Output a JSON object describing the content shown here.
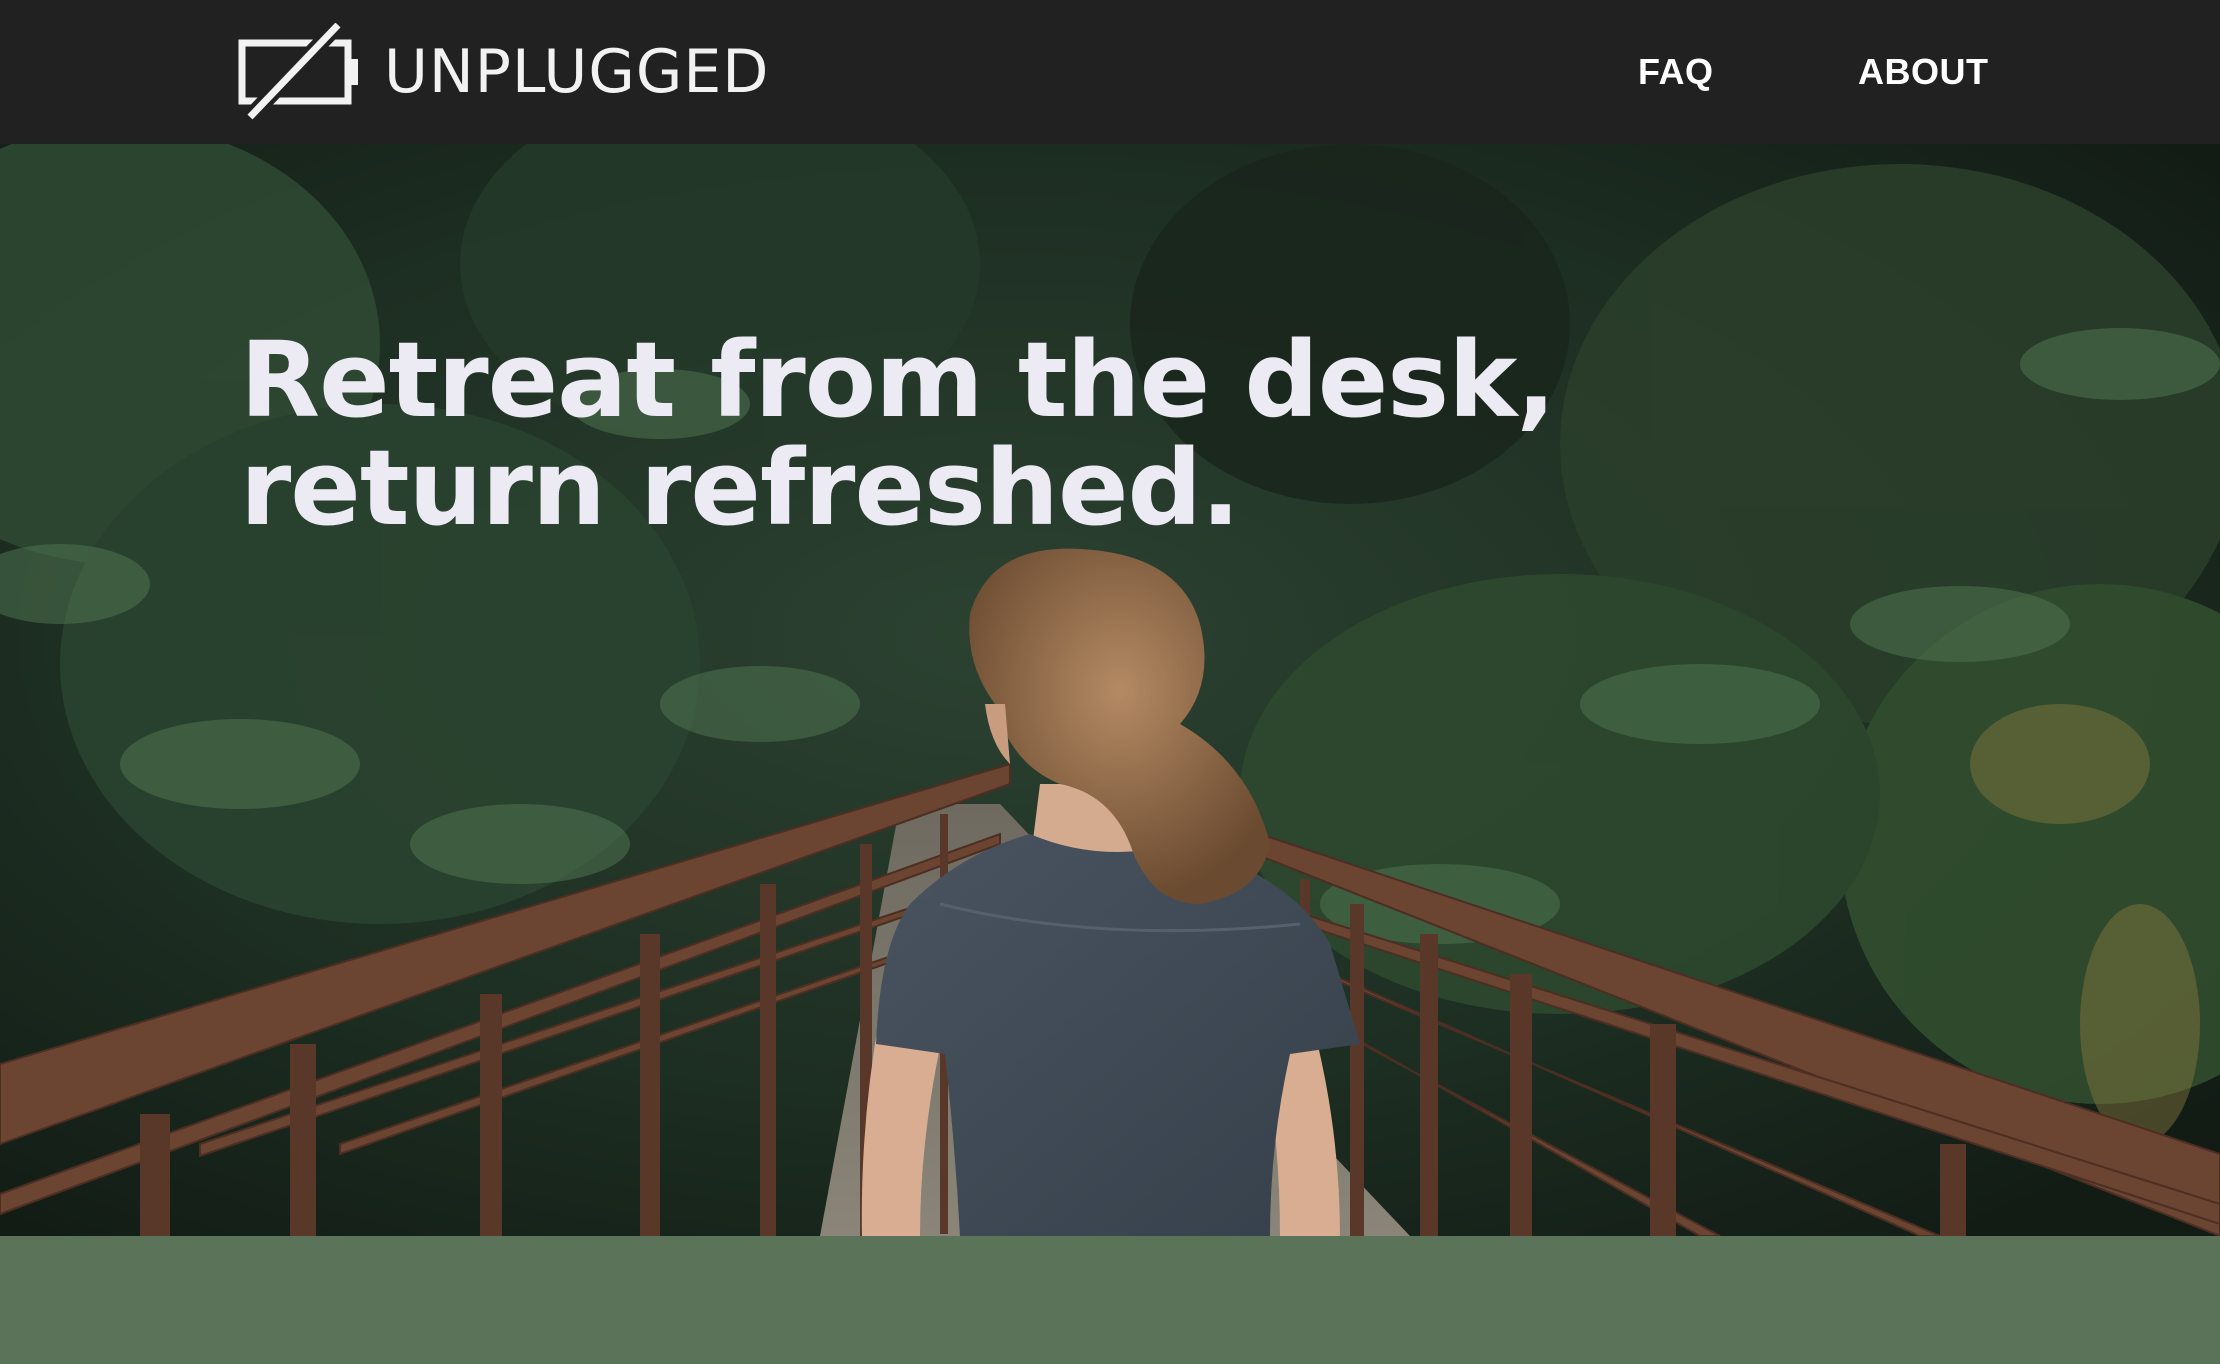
{
  "header": {
    "brand": {
      "name": "UNPLUGGED",
      "icon": "unplugged-battery-icon"
    },
    "nav": [
      {
        "label": "FAQ"
      },
      {
        "label": "ABOUT"
      }
    ]
  },
  "hero": {
    "title_line1": "Retreat from the desk,",
    "title_line2": "return refreshed.",
    "image": "woman-on-forest-bridge-photo"
  },
  "colors": {
    "header_bg": "#212121",
    "band_bg": "#5b7359",
    "title_text": "#ecebf3"
  }
}
